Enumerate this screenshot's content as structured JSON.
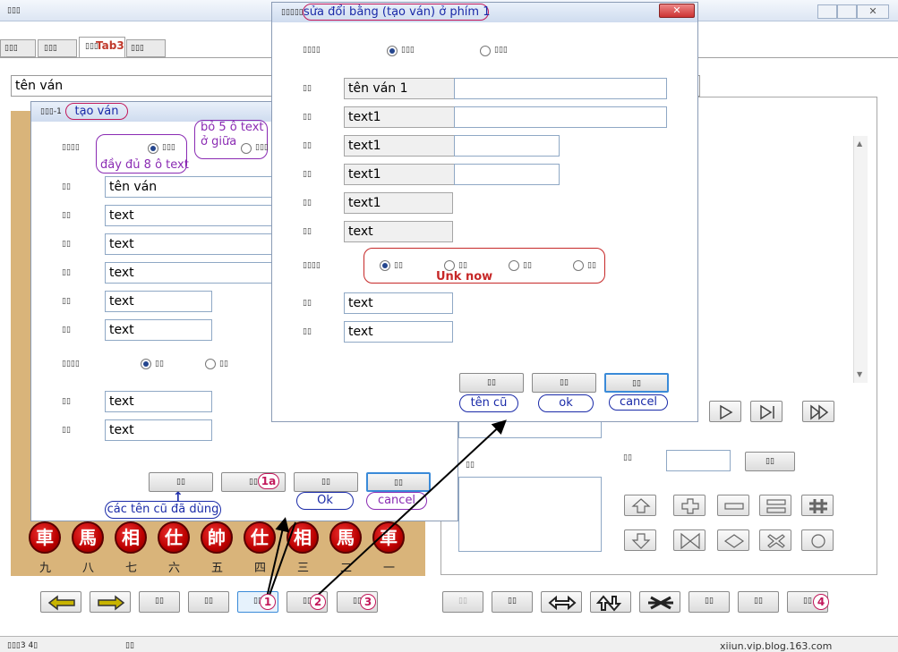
{
  "main": {
    "title": "▯▯▯",
    "tabs": [
      {
        "label": "▯▯▯"
      },
      {
        "label": "▯▯▯"
      },
      {
        "label": "▯▯▯",
        "overlay": "Tab3"
      },
      {
        "label": "▯▯▯"
      }
    ],
    "name_field": "tên ván",
    "bottom_buttons": [
      "▯▯",
      "▯▯",
      "▯▯",
      "▯▯",
      "▯▯"
    ],
    "right_buttons": [
      "▯▯",
      "▯▯",
      "▯▯",
      "▯▯",
      "▯▯",
      "▯▯"
    ],
    "small_label": "▯▯",
    "small_button": "▯▯",
    "status_left": "▯▯▯3 4▯",
    "status_mid": "▯▯",
    "status_right": "xiiun.vip.blog.163.com"
  },
  "create_dialog": {
    "title_prefix": "▯▯▯-1",
    "title_annotation": "tạo ván",
    "radio_label": "▯▯▯▯",
    "radio_opt1": "▯▯▯",
    "radio_opt2": "▯▯▯",
    "row_labels": [
      "▯▯",
      "▯▯",
      "▯▯",
      "▯▯",
      "▯▯",
      "▯▯",
      "▯▯",
      "▯▯"
    ],
    "fields": [
      "tên ván",
      "text",
      "text",
      "text",
      "text",
      "text",
      "text",
      "text"
    ],
    "radio2_label": "▯▯▯▯",
    "radio2_opts": [
      "▯▯",
      "▯▯"
    ],
    "buttons": [
      "▯▯",
      "▯▯",
      "▯▯",
      "▯▯"
    ],
    "anno_full": "đầy đủ 8 ô text",
    "anno_middle": "bỏ 5 ô text\nở giữa",
    "anno_1a": "1a",
    "anno_oldnames": "các tên cũ đã dùng",
    "anno_ok": "Ok",
    "anno_cancel": "cancel"
  },
  "edit_dialog": {
    "title_prefix": "▯▯▯▯▯",
    "title_annotation": "sửa đổi bằng (tạo ván) ở phím 1",
    "radio_label": "▯▯▯▯",
    "radio_opt1": "▯▯▯",
    "radio_opt2": "▯▯▯",
    "row_labels": [
      "▯▯",
      "▯▯",
      "▯▯",
      "▯▯",
      "▯▯",
      "▯▯",
      "▯▯",
      "▯▯"
    ],
    "fields": [
      "tên ván 1",
      "text1",
      "text1",
      "text1",
      "text1",
      "text",
      "text",
      "text"
    ],
    "radio2_label": "▯▯▯▯",
    "radio2_opts": [
      "▯▯",
      "▯▯",
      "▯▯",
      "▯▯"
    ],
    "anno_unk": "Unk now",
    "buttons": [
      "▯▯",
      "▯▯",
      "▯▯"
    ],
    "anno_oldname": "tên cũ",
    "anno_ok": "ok",
    "anno_cancel": "cancel"
  },
  "annotations": {
    "n1": "1",
    "n2": "2",
    "n3": "3",
    "n4": "4"
  },
  "board": {
    "pieces": [
      "車",
      "馬",
      "相",
      "仕",
      "帥",
      "仕",
      "相",
      "馬",
      "車"
    ],
    "columns": [
      "九",
      "八",
      "七",
      "六",
      "五",
      "四",
      "三",
      "二",
      "一"
    ]
  }
}
